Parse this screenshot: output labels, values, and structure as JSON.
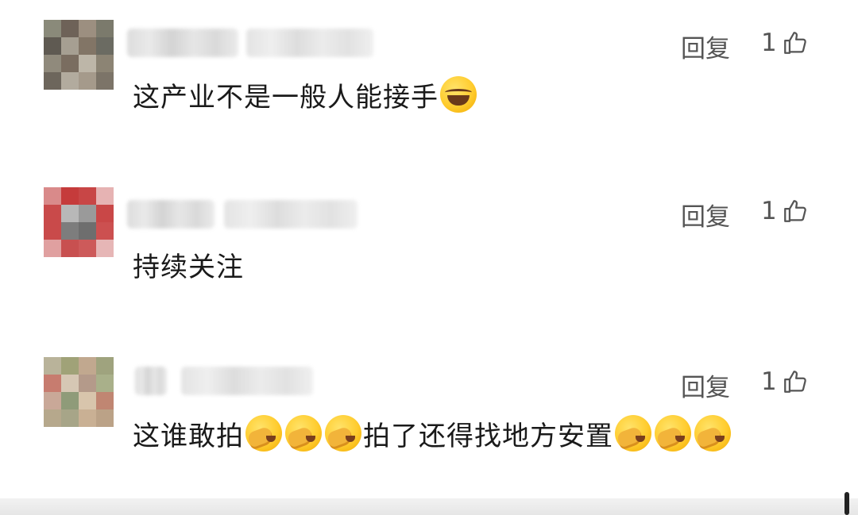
{
  "comments": [
    {
      "text": "这产业不是一般人能接手",
      "emoji_after": "laughing-tears",
      "reply_label": "回复",
      "like_count": "1",
      "avatar_colors": [
        "#8a8a7a",
        "#6e6258",
        "#9c8f80",
        "#7b7a6c",
        "#5f5a52",
        "#a69f92",
        "#827566",
        "#6b6b62",
        "#908a7c",
        "#7a6d60",
        "#bdb6a8",
        "#8c8474",
        "#6d665c",
        "#b2ab9e",
        "#a59a8b",
        "#7c7468"
      ]
    },
    {
      "text": "持续关注",
      "reply_label": "回复",
      "like_count": "1",
      "avatar_colors": [
        "#d98a8a",
        "#c53b3b",
        "#c84646",
        "#e6b3b3",
        "#c94a4a",
        "#b8b8b8",
        "#9a9a9a",
        "#c94747",
        "#c94a4a",
        "#7d7d7d",
        "#6e6e6e",
        "#cc5050",
        "#e0a0a0",
        "#c85050",
        "#cd5a5a",
        "#e6b6b6"
      ]
    },
    {
      "text_part1": "这谁敢拍",
      "text_part2": "拍了还得找地方安置",
      "emoji_middle": "facepalm",
      "emoji_end": "facepalm",
      "reply_label": "回复",
      "like_count": "1",
      "avatar_colors": [
        "#b9b39a",
        "#a0a278",
        "#c1a88f",
        "#9fa37e",
        "#c77c6f",
        "#d6c7b4",
        "#b49a8a",
        "#a9b08a",
        "#c9a898",
        "#8f9b79",
        "#d8c5ac",
        "#c08672",
        "#b6a88c",
        "#a7a588",
        "#c9b094",
        "#bba287"
      ]
    }
  ],
  "icons": {
    "like": "thumbs-up-icon"
  },
  "colors": {
    "text": "#1a1a1a",
    "meta": "#555555",
    "emoji": "#ffcc2e"
  }
}
